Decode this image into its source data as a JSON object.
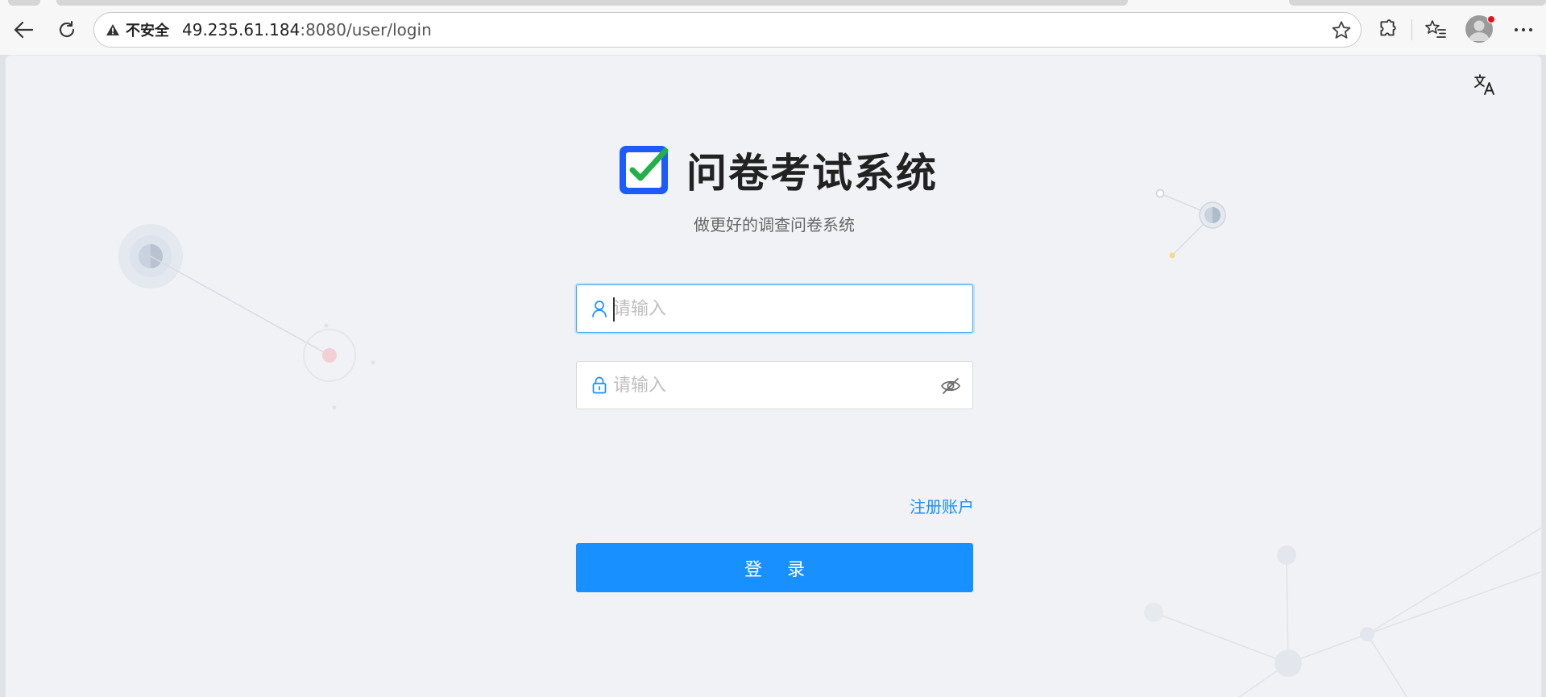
{
  "browser": {
    "security_label": "不安全",
    "url_host": "49.235.61.184",
    "url_path": ":8080/user/login",
    "icons": [
      "back-icon",
      "reload-icon",
      "warning-icon",
      "favorite-star-icon",
      "extensions-icon",
      "favorites-icon",
      "profile-avatar",
      "more-icon"
    ],
    "notification_color": "#e8101b"
  },
  "page": {
    "language_icon": "translate-icon",
    "app_title": "问卷考试系统",
    "subtitle": "做更好的调查问卷系统",
    "username": {
      "placeholder": "请输入",
      "value": "",
      "icon": "user-icon"
    },
    "password": {
      "placeholder": "请输入",
      "value": "",
      "icon": "lock-icon",
      "toggle_icon": "eye-hidden-icon"
    },
    "register_link": "注册账户",
    "login_button": "登 录",
    "accent_color": "#1890ff",
    "logo_colors": {
      "frame": "#1e5bff",
      "check": "#22b04b"
    }
  }
}
